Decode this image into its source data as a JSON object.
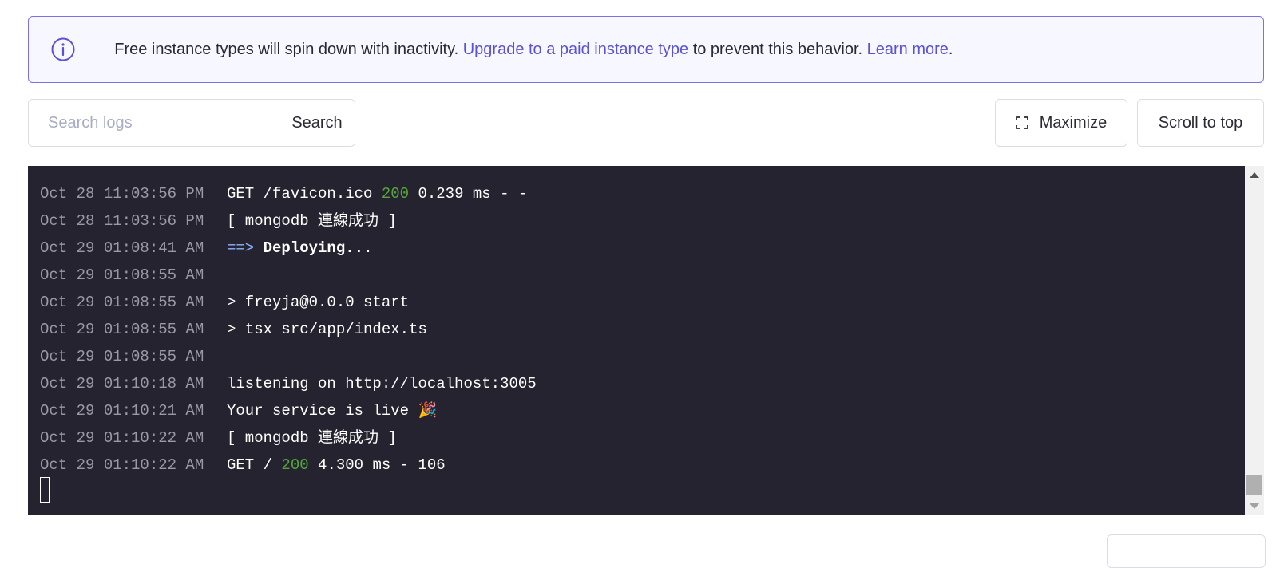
{
  "banner": {
    "text_before": "Free instance types will spin down with inactivity. ",
    "link_upgrade": "Upgrade to a paid instance type",
    "text_middle": " to prevent this behavior. ",
    "link_learn": "Learn more",
    "text_after": "."
  },
  "search": {
    "placeholder": "Search logs",
    "button_label": "Search"
  },
  "toolbar": {
    "maximize_label": "Maximize",
    "scroll_top_label": "Scroll to top"
  },
  "logs": [
    {
      "ts": "Oct 28 11:03:56 PM",
      "parts": [
        {
          "t": "GET /favicon.ico "
        },
        {
          "t": "200",
          "cls": "ok"
        },
        {
          "t": " 0.239 ms - -"
        }
      ]
    },
    {
      "ts": "Oct 28 11:03:56 PM",
      "parts": [
        {
          "t": "[ mongodb 連線成功 ]"
        }
      ]
    },
    {
      "ts": "Oct 29 01:08:41 AM",
      "parts": [
        {
          "t": "==> ",
          "cls": "arrow"
        },
        {
          "t": "Deploying...",
          "cls": "bold"
        }
      ]
    },
    {
      "ts": "Oct 29 01:08:55 AM",
      "parts": []
    },
    {
      "ts": "Oct 29 01:08:55 AM",
      "parts": [
        {
          "t": "> freyja@0.0.0 start"
        }
      ]
    },
    {
      "ts": "Oct 29 01:08:55 AM",
      "parts": [
        {
          "t": "> tsx src/app/index.ts"
        }
      ]
    },
    {
      "ts": "Oct 29 01:08:55 AM",
      "parts": []
    },
    {
      "ts": "Oct 29 01:10:18 AM",
      "parts": [
        {
          "t": "listening on http://localhost:3005"
        }
      ]
    },
    {
      "ts": "Oct 29 01:10:21 AM",
      "parts": [
        {
          "t": "Your service is live 🎉"
        }
      ]
    },
    {
      "ts": "Oct 29 01:10:22 AM",
      "parts": [
        {
          "t": "[ mongodb 連線成功 ]"
        }
      ]
    },
    {
      "ts": "Oct 29 01:10:22 AM",
      "parts": [
        {
          "t": "GET / "
        },
        {
          "t": "200",
          "cls": "ok"
        },
        {
          "t": " 4.300 ms - 106"
        }
      ]
    }
  ],
  "icons": {
    "info": "info-circle-icon",
    "maximize": "maximize-icon"
  },
  "colors": {
    "accent": "#5a52d5",
    "terminal_bg": "#24232f",
    "status_ok": "#57a63a"
  }
}
